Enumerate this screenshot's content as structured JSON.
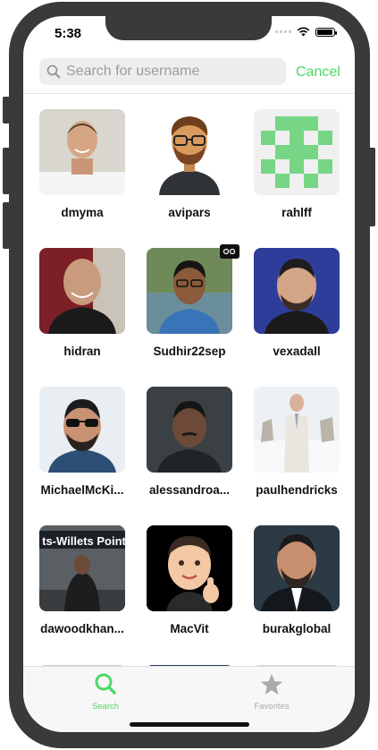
{
  "status_bar": {
    "time": "5:38"
  },
  "search": {
    "placeholder": "Search for username",
    "value": "",
    "cancel_label": "Cancel"
  },
  "users": [
    {
      "username": "dmyma"
    },
    {
      "username": "avipars"
    },
    {
      "username": "rahlff"
    },
    {
      "username": "hidran"
    },
    {
      "username": "Sudhir22sep"
    },
    {
      "username": "vexadall"
    },
    {
      "username": "MichaelMcKi..."
    },
    {
      "username": "alessandroa..."
    },
    {
      "username": "paulhendricks"
    },
    {
      "username": "dawoodkhan..."
    },
    {
      "username": "MacVit"
    },
    {
      "username": "burakglobal"
    }
  ],
  "tabbar": {
    "tabs": [
      {
        "label": "Search",
        "icon": "search-icon",
        "active": true
      },
      {
        "label": "Favorites",
        "icon": "star-icon",
        "active": false
      }
    ]
  },
  "colors": {
    "accent": "#4cd964",
    "inactive": "#a9a9ae"
  }
}
